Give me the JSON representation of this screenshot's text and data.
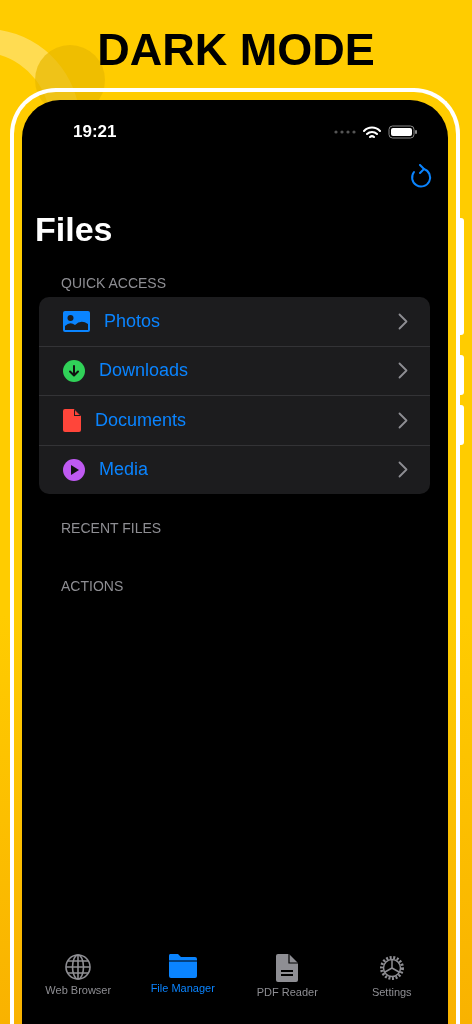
{
  "headline": "DARK MODE",
  "status_bar": {
    "time": "19:21"
  },
  "title": "Files",
  "sections": [
    {
      "kind": "list",
      "header": "QUICK ACCESS",
      "items": [
        {
          "kind": "photos",
          "label": "Photos"
        },
        {
          "kind": "downloads",
          "label": "Downloads"
        },
        {
          "kind": "documents",
          "label": "Documents"
        },
        {
          "kind": "media",
          "label": "Media"
        }
      ]
    },
    {
      "kind": "empty",
      "header": "RECENT FILES"
    },
    {
      "kind": "empty",
      "header": "ACTIONS"
    }
  ],
  "tabs": [
    {
      "kind": "globe",
      "label": "Web Browser",
      "selected": false
    },
    {
      "kind": "folder",
      "label": "File Manager",
      "selected": true
    },
    {
      "kind": "document",
      "label": "PDF Reader",
      "selected": false
    },
    {
      "kind": "gear",
      "label": "Settings",
      "selected": false
    }
  ]
}
